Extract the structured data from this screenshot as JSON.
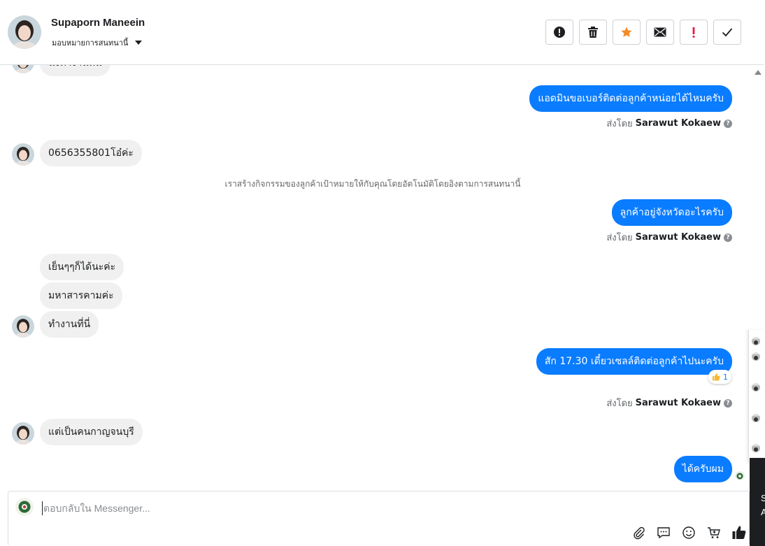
{
  "header": {
    "contact_name": "Supaporn Maneein",
    "assign_label": "มอบหมายการสนทนานี้"
  },
  "actions": [
    "spam-report",
    "delete",
    "star",
    "mark-unread",
    "important",
    "done"
  ],
  "messages": {
    "partial_top": "นั่งทำงานที่นี่",
    "out1": "แอดมินขอเบอร์ติดต่อลูกค้าหน่อยได้ไหมครับ",
    "in1": "0656355801โอ๋ค่ะ",
    "system": "เราสร้างกิจกรรมของลูกค้าเป้าหมายให้กับคุณโดยอัตโนมัติโดยอิงตามการสนทนานี้",
    "out2": "ลูกค้าอยู่จังหวัดอะไรครับ",
    "in2": "เย็นๆๆก็ได้นะค่ะ",
    "in3": "มหาสารคามค่ะ",
    "in4": "ทำงานที่นี่",
    "out3": "สัก 17.30 เดี๋ยวเซลล์ติดต่อลูกค้าไปนะครับ",
    "reaction_count": "1",
    "in5": "แต่เป็นคนกาญจนบุรี",
    "out4": "ได้ครับผม"
  },
  "sent_by": {
    "prefix": "ส่งโดย",
    "name": "Sarawut Kokaew"
  },
  "composer": {
    "placeholder": "ตอบกลับใน Messenger..."
  },
  "side_panel": {
    "text1": "S",
    "text2": "A"
  }
}
